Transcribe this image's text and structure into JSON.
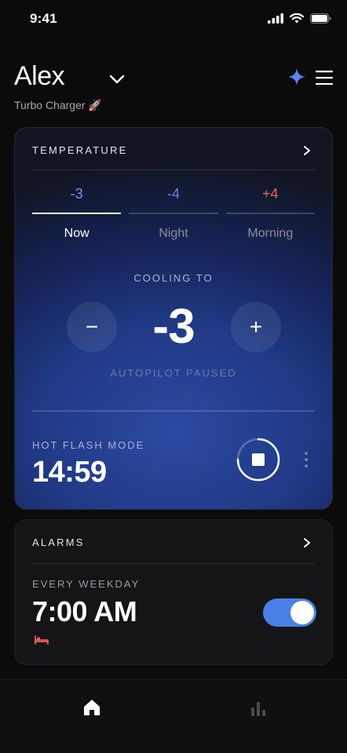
{
  "status_bar": {
    "time": "9:41"
  },
  "header": {
    "user_name": "Alex",
    "device_name": "Turbo Charger 🚀"
  },
  "temperature_card": {
    "title": "TEMPERATURE",
    "tabs": [
      {
        "value": "-3",
        "label": "Now",
        "active": true,
        "value_color": "#6f9cf5"
      },
      {
        "value": "-4",
        "label": "Night",
        "active": false,
        "value_color": "#5f86e0"
      },
      {
        "value": "+4",
        "label": "Morning",
        "active": false,
        "value_color": "#e8625a"
      }
    ],
    "status_label": "COOLING TO",
    "current_value": "-3",
    "minus_label": "−",
    "plus_label": "+",
    "autopilot_text": "AUTOPILOT PAUSED",
    "hot_flash": {
      "label": "HOT FLASH MODE",
      "time": "14:59"
    }
  },
  "alarms_card": {
    "title": "ALARMS",
    "schedule": "EVERY WEEKDAY",
    "time": "7:00 AM",
    "enabled": true
  },
  "colors": {
    "accent": "#4a7fe8",
    "warm": "#e8625a",
    "cool": "#6f9cf5"
  },
  "icons": [
    "signal-icon",
    "wifi-icon",
    "battery-icon",
    "chevron-down-icon",
    "sparkle-icon",
    "menu-icon",
    "chevron-right-icon",
    "stop-icon",
    "kebab-icon",
    "bed-icon",
    "home-icon",
    "stats-icon"
  ]
}
